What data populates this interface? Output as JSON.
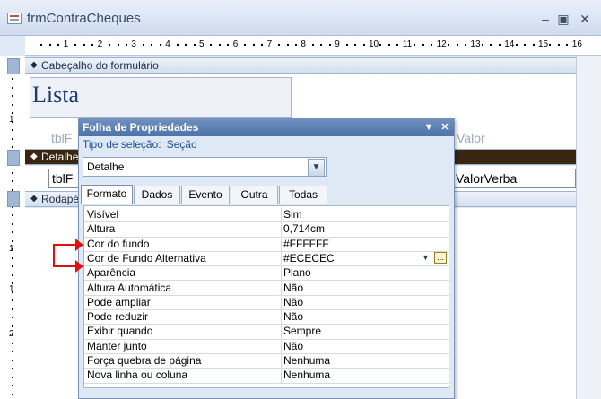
{
  "window": {
    "title": "frmContraCheques",
    "minimize": "–",
    "restore": "▣",
    "close": "✕"
  },
  "ruler_numbers": [
    "1",
    "2",
    "3",
    "4",
    "5",
    "6",
    "7",
    "8",
    "9",
    "10",
    "11",
    "12",
    "13",
    "14",
    "15",
    "16"
  ],
  "ruler_left_numbers": [
    "1",
    "1",
    "1",
    "2"
  ],
  "form": {
    "header_section": "Cabeçalho do formulário",
    "detail_section": "Detalhe",
    "footer_section": "Rodapé",
    "title_label": "Lista",
    "ghost_header_left": "tblF",
    "ghost_header_right": "Valor",
    "detail_field_left": "tblF",
    "detail_field_right": "ValorVerba"
  },
  "property_sheet": {
    "title": "Folha de Propriedades",
    "selection_label": "Tipo de seleção:",
    "selection_value": "Seção",
    "dropdown_value": "Detalhe",
    "tabs": [
      "Formato",
      "Dados",
      "Evento",
      "Outra",
      "Todas"
    ],
    "active_tab": "Formato",
    "rows": [
      {
        "name": "Visível",
        "value": "Sim"
      },
      {
        "name": "Altura",
        "value": "0,714cm"
      },
      {
        "name": "Cor do fundo",
        "value": "#FFFFFF"
      },
      {
        "name": "Cor de Fundo Alternativa",
        "value": "#ECECEC"
      },
      {
        "name": "Aparência",
        "value": "Plano"
      },
      {
        "name": "Altura Automática",
        "value": "Não"
      },
      {
        "name": "Pode ampliar",
        "value": "Não"
      },
      {
        "name": "Pode reduzir",
        "value": "Não"
      },
      {
        "name": "Exibir quando",
        "value": "Sempre"
      },
      {
        "name": "Manter junto",
        "value": "Não"
      },
      {
        "name": "Força quebra de página",
        "value": "Nenhuma"
      },
      {
        "name": "Nova linha ou coluna",
        "value": "Nenhuma"
      }
    ]
  },
  "colors": {
    "accent": "#4e73a8",
    "annotation": "#e01010",
    "detail_bar": "#3a2510"
  }
}
